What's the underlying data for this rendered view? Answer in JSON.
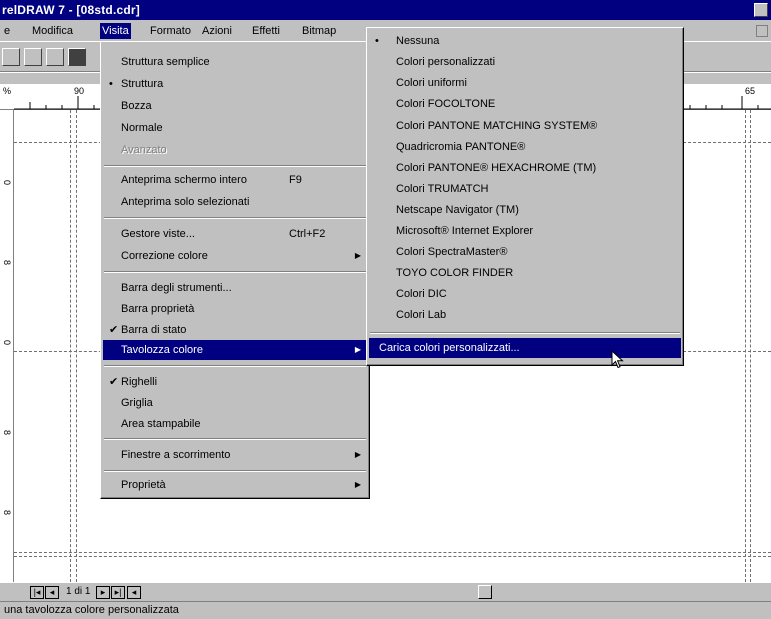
{
  "window": {
    "title": "relDRAW 7 - [08std.cdr]"
  },
  "menubar": {
    "items": [
      {
        "label": "e"
      },
      {
        "label": "Modifica"
      },
      {
        "label": "Visita"
      },
      {
        "label": "Formato"
      },
      {
        "label": "Azioni"
      },
      {
        "label": "Effetti"
      },
      {
        "label": "Bitmap"
      },
      {
        "label": "Nessuna"
      }
    ]
  },
  "ruler": {
    "top_labels": [
      "%",
      "90",
      "65"
    ],
    "left_labels": [
      "0",
      "8",
      "0",
      "8",
      "8"
    ]
  },
  "view_menu": {
    "items": [
      {
        "label": "Struttura semplice",
        "shortcut": "",
        "mark": "",
        "state": "normal"
      },
      {
        "label": "Struttura",
        "shortcut": "",
        "mark": "•",
        "state": "normal"
      },
      {
        "label": "Bozza",
        "shortcut": "",
        "mark": "",
        "state": "normal"
      },
      {
        "label": "Normale",
        "shortcut": "",
        "mark": "",
        "state": "normal"
      },
      {
        "label": "Avanzato",
        "shortcut": "",
        "mark": "",
        "state": "disabled"
      },
      {
        "label": "Anteprima schermo intero",
        "shortcut": "F9",
        "mark": "",
        "state": "normal"
      },
      {
        "label": "Anteprima solo selezionati",
        "shortcut": "",
        "mark": "",
        "state": "normal"
      },
      {
        "label": "Gestore viste...",
        "shortcut": "Ctrl+F2",
        "mark": "",
        "state": "normal"
      },
      {
        "label": "Correzione colore",
        "shortcut": "",
        "mark": "",
        "state": "submenu"
      },
      {
        "label": "Barra degli strumenti...",
        "shortcut": "",
        "mark": "",
        "state": "normal"
      },
      {
        "label": "Barra proprietà",
        "shortcut": "",
        "mark": "",
        "state": "normal"
      },
      {
        "label": "Barra di stato",
        "shortcut": "",
        "mark": "✔",
        "state": "normal"
      },
      {
        "label": "Tavolozza colore",
        "shortcut": "",
        "mark": "",
        "state": "submenu-selected"
      },
      {
        "label": "Righelli",
        "shortcut": "",
        "mark": "✔",
        "state": "normal"
      },
      {
        "label": "Griglia",
        "shortcut": "",
        "mark": "",
        "state": "normal"
      },
      {
        "label": "Area stampabile",
        "shortcut": "",
        "mark": "",
        "state": "normal"
      },
      {
        "label": "Finestre a scorrimento",
        "shortcut": "",
        "mark": "",
        "state": "submenu"
      },
      {
        "label": "Proprietà",
        "shortcut": "",
        "mark": "",
        "state": "submenu"
      }
    ]
  },
  "palette_menu": {
    "items": [
      {
        "label": "Nessuna",
        "mark": "•",
        "state": "normal"
      },
      {
        "label": "Colori personalizzati",
        "mark": "",
        "state": "normal"
      },
      {
        "label": "Colori uniformi",
        "mark": "",
        "state": "normal"
      },
      {
        "label": "Colori FOCOLTONE",
        "mark": "",
        "state": "normal"
      },
      {
        "label": "Colori PANTONE MATCHING SYSTEM®",
        "mark": "",
        "state": "normal"
      },
      {
        "label": "Quadricromia PANTONE®",
        "mark": "",
        "state": "normal"
      },
      {
        "label": "Colori PANTONE® HEXACHROME (TM)",
        "mark": "",
        "state": "normal"
      },
      {
        "label": "Colori TRUMATCH",
        "mark": "",
        "state": "normal"
      },
      {
        "label": "Netscape Navigator (TM)",
        "mark": "",
        "state": "normal"
      },
      {
        "label": "Microsoft® Internet Explorer",
        "mark": "",
        "state": "normal"
      },
      {
        "label": "Colori SpectraMaster®",
        "mark": "",
        "state": "normal"
      },
      {
        "label": "TOYO COLOR FINDER",
        "mark": "",
        "state": "normal"
      },
      {
        "label": "Colori DIC",
        "mark": "",
        "state": "normal"
      },
      {
        "label": "Colori Lab",
        "mark": "",
        "state": "normal"
      },
      {
        "label": "Carica colori personalizzati...",
        "mark": "",
        "state": "selected"
      }
    ]
  },
  "page_nav": {
    "page_label": "1 di 1"
  },
  "statusbar": {
    "text": "una tavolozza colore personalizzata"
  },
  "colors": {
    "highlight": "#000080",
    "face": "#c0c0c0",
    "canvas": "#ffffff"
  }
}
